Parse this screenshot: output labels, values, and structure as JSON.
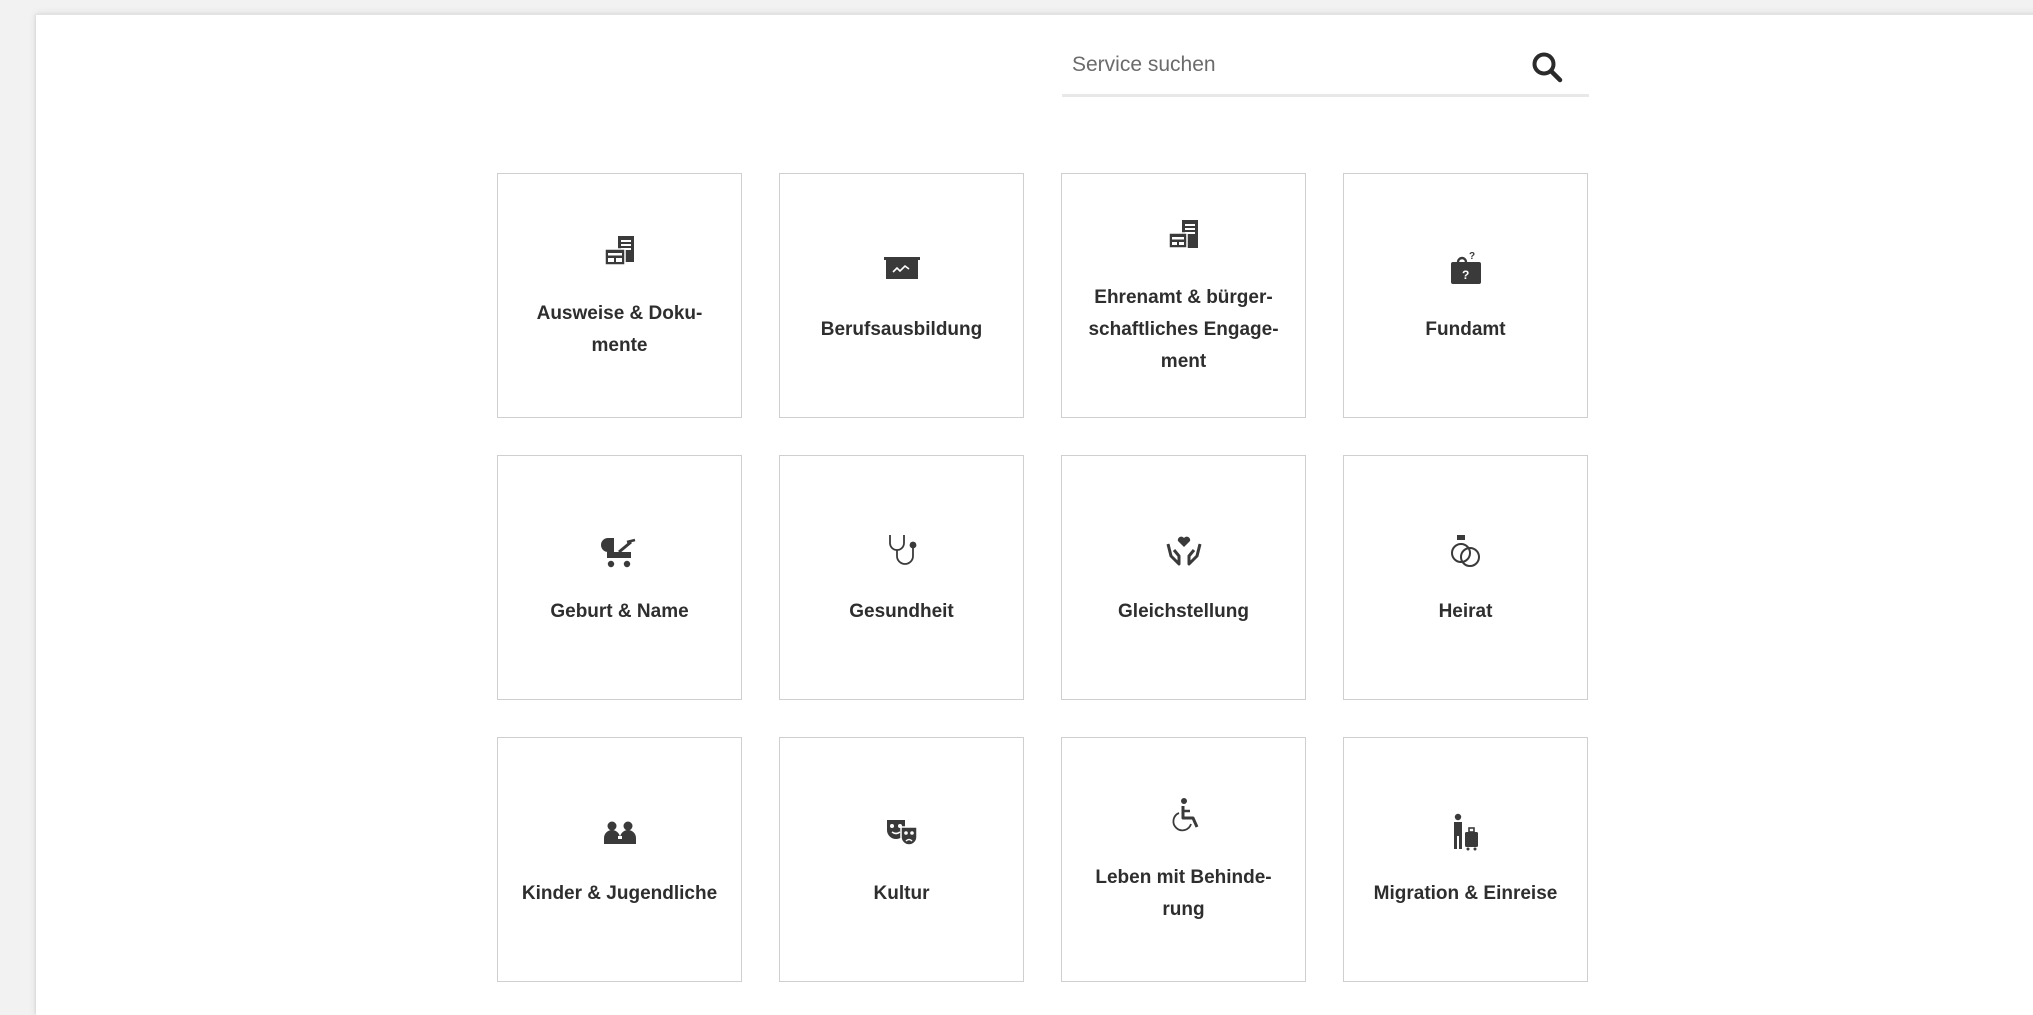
{
  "search": {
    "placeholder": "Service suchen",
    "value": "",
    "icon": "search-icon"
  },
  "tiles": [
    {
      "label": "Ausweise & Doku-\nmente",
      "icon": "documents-icon"
    },
    {
      "label": "Berufsausbildung",
      "icon": "chalkboard-icon"
    },
    {
      "label": "Ehrenamt & bürger-\nschaftliches Engage-\nment",
      "icon": "buildings-icon"
    },
    {
      "label": "Fundamt",
      "icon": "lost-bag-icon"
    },
    {
      "label": "Geburt & Name",
      "icon": "stroller-icon"
    },
    {
      "label": "Gesundheit",
      "icon": "stethoscope-icon"
    },
    {
      "label": "Gleichstellung",
      "icon": "hands-heart-icon"
    },
    {
      "label": "Heirat",
      "icon": "rings-icon"
    },
    {
      "label": "Kinder & Jugendliche",
      "icon": "children-icon"
    },
    {
      "label": "Kultur",
      "icon": "theater-masks-icon"
    },
    {
      "label": "Leben mit Behinde-\nrung",
      "icon": "wheelchair-icon"
    },
    {
      "label": "Migration & Einreise",
      "icon": "traveler-icon"
    }
  ],
  "colors": {
    "icon": "#3a3a3a",
    "tile_border": "#cfcfcf",
    "search_underline": "#e8e8e8"
  }
}
